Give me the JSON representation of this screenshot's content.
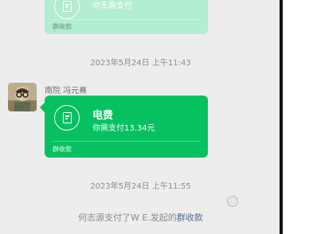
{
  "messages": [
    {
      "id": "prev_card",
      "subtitle_partial": "你无需支付",
      "footer": "群收款"
    }
  ],
  "timestamps": [
    "2023年5月24日 上午11:43",
    "2023年5月24日 上午11:55"
  ],
  "sender": {
    "name": "南院 冯元熹",
    "avatar": "avatar-photo"
  },
  "payment_card": {
    "title": "电费",
    "subtitle": "你需支付13.34元",
    "footer": "群收款",
    "icon": "document-icon",
    "bg_color": "#07c160"
  },
  "system_message": {
    "text": "何志源支付了W E.发起的",
    "link": "群收款"
  },
  "colors": {
    "background": "#ededed",
    "card_green": "#07c160",
    "faded_card": "#b3ecce",
    "link": "#576b95"
  }
}
